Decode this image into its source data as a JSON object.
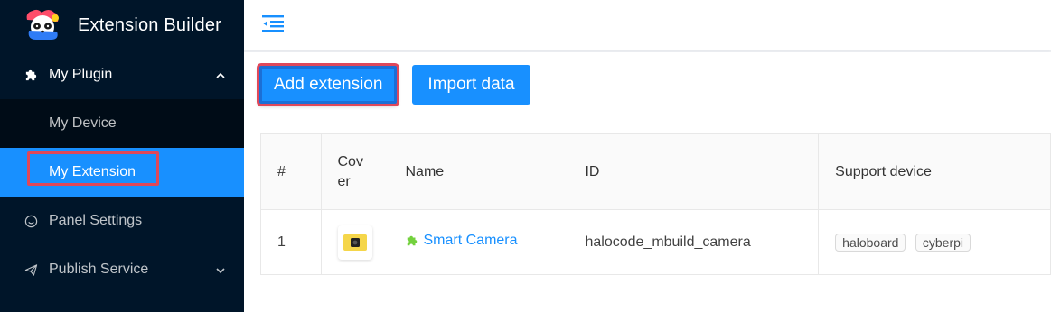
{
  "brand": {
    "title": "Extension Builder",
    "logo_icon": "panda-logo-icon"
  },
  "sidebar": {
    "plugin_menu": {
      "label": "My Plugin",
      "icon": "puzzle-icon",
      "items": [
        {
          "label": "My Device"
        },
        {
          "label": "My Extension"
        }
      ]
    },
    "panel_settings": {
      "label": "Panel Settings",
      "icon": "smile-icon"
    },
    "publish_service": {
      "label": "Publish Service",
      "icon": "send-icon"
    }
  },
  "header": {
    "toggle_icon": "menu-fold-icon"
  },
  "toolbar": {
    "add_label": "Add extension",
    "import_label": "Import data"
  },
  "table": {
    "headers": {
      "num": "#",
      "cover": "Cov er",
      "name": "Name",
      "id": "ID",
      "support": "Support device"
    },
    "rows": [
      {
        "num": "1",
        "name": "Smart Camera",
        "id": "halocode_mbuild_camera",
        "devices": [
          "haloboard",
          "cyberpi"
        ]
      }
    ]
  },
  "colors": {
    "sidebar_bg": "#001529",
    "accent": "#1890ff",
    "highlight": "#e0485a"
  }
}
